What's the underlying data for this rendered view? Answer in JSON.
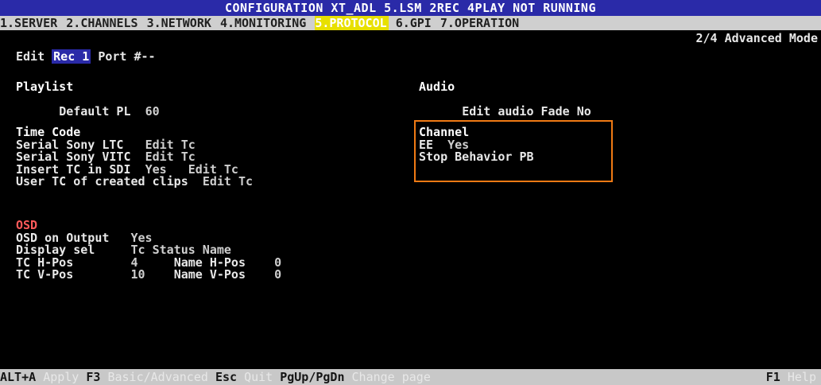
{
  "title": "CONFIGURATION XT_ADL 5.LSM  2REC 4PLAY NOT RUNNING",
  "tabs": [
    {
      "label": "1.SERVER",
      "active": false
    },
    {
      "label": "2.CHANNELS",
      "active": false
    },
    {
      "label": "3.NETWORK",
      "active": false
    },
    {
      "label": "4.MONITORING",
      "active": false
    },
    {
      "label": "5.PROTOCOL",
      "active": true
    },
    {
      "label": "6.GPI",
      "active": false
    },
    {
      "label": "7.OPERATION",
      "active": false
    }
  ],
  "mode": "2/4 Advanced Mode",
  "edit": {
    "prefix": "Edit",
    "rec": "Rec 1",
    "port": "Port #--"
  },
  "playlist": {
    "header": "Playlist",
    "default_label": "Default PL",
    "default_value": "60"
  },
  "audio": {
    "header": "Audio",
    "fade_label": "Edit audio Fade",
    "fade_value": "No"
  },
  "timecode": {
    "header": "Time Code",
    "rows": [
      {
        "label": "Serial Sony LTC",
        "value": "Edit Tc"
      },
      {
        "label": "Serial Sony VITC",
        "value": "Edit Tc"
      },
      {
        "label": "Insert TC in SDI",
        "value": "Yes",
        "extra": "Edit Tc"
      },
      {
        "label": "User TC of created clips",
        "value": "Edit Tc"
      }
    ]
  },
  "channel": {
    "header": "Channel",
    "ee_label": "EE",
    "ee_value": "Yes",
    "stop_label": "Stop Behavior",
    "stop_value": "PB"
  },
  "osd": {
    "header": "OSD",
    "on_output_label": "OSD on Output",
    "on_output_value": "Yes",
    "display_label": "Display sel",
    "display_value": "Tc Status Name",
    "tch_label": "TC H-Pos",
    "tch_value": "4",
    "nameh_label": "Name H-Pos",
    "nameh_value": "0",
    "tcv_label": "TC V-Pos",
    "tcv_value": "10",
    "namev_label": "Name V-Pos",
    "namev_value": "0"
  },
  "footer": {
    "k1": "ALT+A",
    "a1": "Apply",
    "k2": "F3",
    "a2": "Basic/Advanced",
    "k3": "Esc",
    "a3": "Quit",
    "k4": "PgUp/PgDn",
    "a4": "Change page",
    "k5": "F1",
    "a5": "Help"
  },
  "colors": {
    "background": "#000000",
    "title_bar": "#2a2aa8",
    "active_tab": "#e8e000",
    "highlight_box": "#f07a14"
  }
}
